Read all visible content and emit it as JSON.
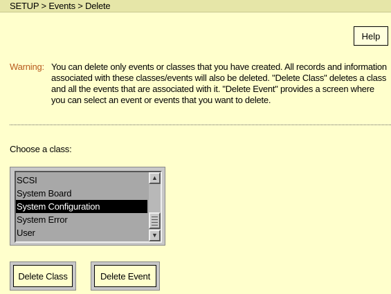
{
  "breadcrumb": "SETUP > Events > Delete",
  "help_label": "Help",
  "warning": {
    "label": "Warning:",
    "text": "You can delete only events or classes that you have created. All records and information associated with these classes/events will also be deleted. \"Delete Class\" deletes a class and all the events that are associated with it. \"Delete Event\" provides a screen where you can select an event or events that you want to delete."
  },
  "class_chooser": {
    "label": "Choose a class:",
    "items": [
      {
        "label": "SCSI",
        "selected": false
      },
      {
        "label": "System Board",
        "selected": false
      },
      {
        "label": "System Configuration",
        "selected": true
      },
      {
        "label": "System Error",
        "selected": false
      },
      {
        "label": "User",
        "selected": false
      }
    ]
  },
  "buttons": {
    "delete_class": "Delete Class",
    "delete_event": "Delete Event"
  },
  "icons": {
    "scroll_up": "scroll-up-arrow-icon",
    "scroll_down": "scroll-down-arrow-icon"
  }
}
